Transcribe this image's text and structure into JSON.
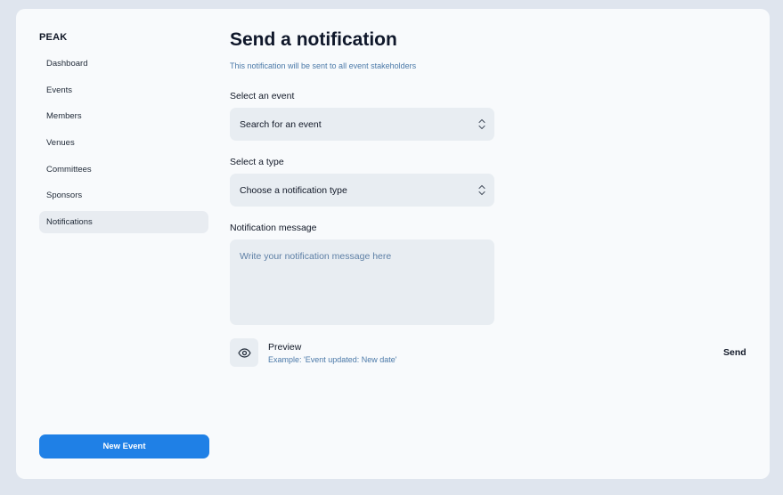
{
  "sidebar": {
    "brand": "PEAK",
    "items": [
      {
        "label": "Dashboard"
      },
      {
        "label": "Events"
      },
      {
        "label": "Members"
      },
      {
        "label": "Venues"
      },
      {
        "label": "Committees"
      },
      {
        "label": "Sponsors"
      },
      {
        "label": "Notifications",
        "active": true
      }
    ],
    "new_event_label": "New Event"
  },
  "main": {
    "title": "Send a notification",
    "subtitle": "This notification will be sent to all event stakeholders",
    "event_field": {
      "label": "Select an event",
      "value": "Search for an event"
    },
    "type_field": {
      "label": "Select a type",
      "value": "Choose a notification type"
    },
    "message_field": {
      "label": "Notification message",
      "placeholder": "Write your notification message here",
      "value": ""
    },
    "preview": {
      "icon": "eye-icon",
      "title": "Preview",
      "example": "Example: 'Event updated: New date'"
    },
    "send_label": "Send"
  },
  "colors": {
    "page_bg": "#dfe5ee",
    "card_bg": "#f8fafc",
    "field_bg": "#e8edf2",
    "accent": "#1f80e6",
    "muted_text": "#4b79a8"
  }
}
